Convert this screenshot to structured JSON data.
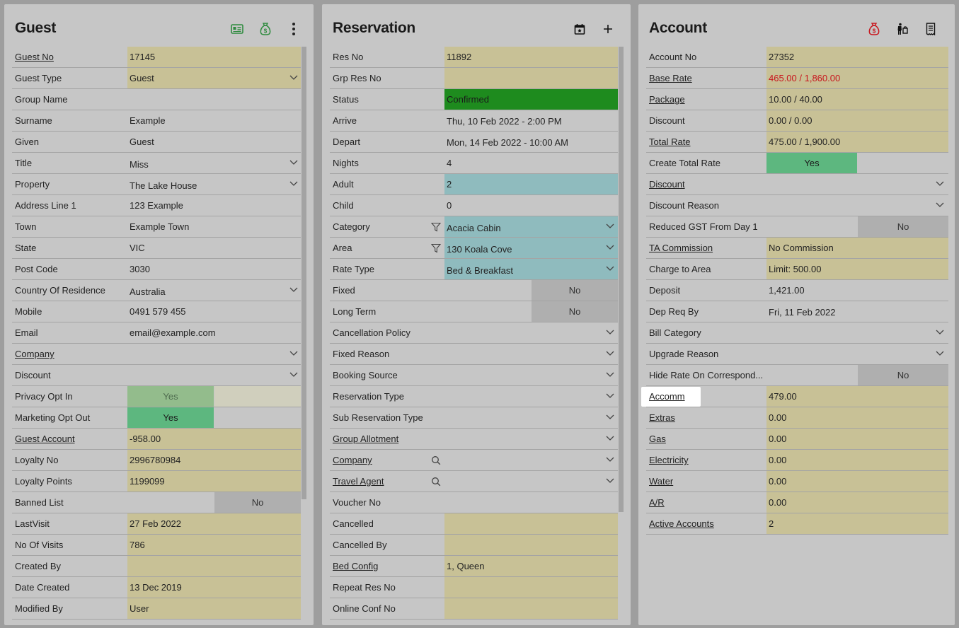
{
  "guest": {
    "title": "Guest",
    "icons": [
      "id-card-icon",
      "money-bag-icon",
      "more-menu-icon"
    ],
    "fields": {
      "guest_no": {
        "label": "Guest No",
        "value": "17145"
      },
      "guest_type": {
        "label": "Guest Type",
        "value": "Guest"
      },
      "group_name": {
        "label": "Group Name",
        "value": ""
      },
      "surname": {
        "label": "Surname",
        "value": "Example"
      },
      "given": {
        "label": "Given",
        "value": "Guest"
      },
      "title": {
        "label": "Title",
        "value": "Miss"
      },
      "property": {
        "label": "Property",
        "value": "The Lake House"
      },
      "address1": {
        "label": "Address Line 1",
        "value": "123 Example"
      },
      "town": {
        "label": "Town",
        "value": "Example Town"
      },
      "state": {
        "label": "State",
        "value": "VIC"
      },
      "post_code": {
        "label": "Post Code",
        "value": "3030"
      },
      "country": {
        "label": "Country Of Residence",
        "value": "Australia"
      },
      "mobile": {
        "label": "Mobile",
        "value": "0491 579 455"
      },
      "email": {
        "label": "Email",
        "value": "email@example.com"
      },
      "company": {
        "label": "Company",
        "value": ""
      },
      "discount": {
        "label": "Discount",
        "value": ""
      },
      "privacy": {
        "label": "Privacy Opt In",
        "value": "Yes"
      },
      "marketing": {
        "label": "Marketing Opt Out",
        "value": "Yes"
      },
      "guest_account": {
        "label": "Guest Account",
        "value": "-958.00"
      },
      "loyalty_no": {
        "label": "Loyalty No",
        "value": "2996780984"
      },
      "loyalty_points": {
        "label": "Loyalty Points",
        "value": "1199099"
      },
      "banned": {
        "label": "Banned List",
        "value": "No"
      },
      "last_visit": {
        "label": "LastVisit",
        "value": "27 Feb 2022"
      },
      "visits": {
        "label": "No Of Visits",
        "value": "786"
      },
      "created_by": {
        "label": "Created By",
        "value": ""
      },
      "date_created": {
        "label": "Date Created",
        "value": "13 Dec 2019"
      },
      "modified_by": {
        "label": "Modified By",
        "value": "User"
      }
    }
  },
  "reservation": {
    "title": "Reservation",
    "icons": [
      "calendar-icon",
      "add-icon"
    ],
    "fields": {
      "res_no": {
        "label": "Res No",
        "value": "11892"
      },
      "grp_res_no": {
        "label": "Grp Res No",
        "value": ""
      },
      "status": {
        "label": "Status",
        "value": "Confirmed"
      },
      "arrive": {
        "label": "Arrive",
        "value": "Thu, 10 Feb 2022 - 2:00 PM"
      },
      "depart": {
        "label": "Depart",
        "value": "Mon, 14 Feb 2022 - 10:00 AM"
      },
      "nights": {
        "label": "Nights",
        "value": "4"
      },
      "adult": {
        "label": "Adult",
        "value": "2"
      },
      "child": {
        "label": "Child",
        "value": "0"
      },
      "category": {
        "label": "Category",
        "value": "Acacia Cabin"
      },
      "area": {
        "label": "Area",
        "value": "130 Koala Cove"
      },
      "rate_type": {
        "label": "Rate Type",
        "value": "Bed & Breakfast"
      },
      "fixed": {
        "label": "Fixed",
        "value": "No"
      },
      "long_term": {
        "label": "Long Term",
        "value": "No"
      },
      "cancel_policy": {
        "label": "Cancellation Policy",
        "value": ""
      },
      "fixed_reason": {
        "label": "Fixed Reason",
        "value": ""
      },
      "booking_source": {
        "label": "Booking Source",
        "value": ""
      },
      "res_type": {
        "label": "Reservation Type",
        "value": ""
      },
      "sub_res_type": {
        "label": "Sub Reservation Type",
        "value": ""
      },
      "group_allot": {
        "label": "Group Allotment",
        "value": ""
      },
      "company": {
        "label": "Company",
        "value": ""
      },
      "travel_agent": {
        "label": "Travel Agent",
        "value": ""
      },
      "voucher_no": {
        "label": "Voucher No",
        "value": ""
      },
      "cancelled": {
        "label": "Cancelled",
        "value": ""
      },
      "cancelled_by": {
        "label": "Cancelled By",
        "value": ""
      },
      "bed_config": {
        "label": "Bed Config",
        "value": "1, Queen"
      },
      "repeat_res": {
        "label": "Repeat Res No",
        "value": ""
      },
      "online_conf": {
        "label": "Online Conf No",
        "value": ""
      }
    }
  },
  "account": {
    "title": "Account",
    "icons": [
      "money-bag-icon",
      "guest-luggage-icon",
      "receipt-icon"
    ],
    "fields": {
      "account_no": {
        "label": "Account No",
        "value": "27352"
      },
      "base_rate": {
        "label": "Base Rate",
        "value": "465.00 / 1,860.00"
      },
      "package": {
        "label": "Package",
        "value": "10.00 / 40.00"
      },
      "discount": {
        "label": "Discount",
        "value": "0.00 / 0.00"
      },
      "total_rate": {
        "label": "Total Rate",
        "value": "475.00 / 1,900.00"
      },
      "create_total": {
        "label": "Create Total Rate",
        "value": "Yes"
      },
      "discount2": {
        "label": "Discount",
        "value": ""
      },
      "discount_reason": {
        "label": "Discount Reason",
        "value": ""
      },
      "reduced_gst": {
        "label": "Reduced GST From Day 1",
        "value": "No"
      },
      "ta_commission": {
        "label": "TA Commission",
        "value": "No Commission"
      },
      "charge_area": {
        "label": "Charge to Area",
        "value": "Limit: 500.00"
      },
      "deposit": {
        "label": "Deposit",
        "value": "1,421.00"
      },
      "dep_req_by": {
        "label": "Dep Req By",
        "value": "Fri, 11 Feb 2022"
      },
      "bill_category": {
        "label": "Bill Category",
        "value": ""
      },
      "upgrade_reason": {
        "label": "Upgrade Reason",
        "value": ""
      },
      "hide_rate": {
        "label": "Hide Rate On Correspond...",
        "value": "No"
      },
      "accomm": {
        "label": "Accomm",
        "value": "479.00"
      },
      "extras": {
        "label": "Extras",
        "value": "0.00"
      },
      "gas": {
        "label": "Gas",
        "value": "0.00"
      },
      "electricity": {
        "label": "Electricity",
        "value": "0.00"
      },
      "water": {
        "label": "Water",
        "value": "0.00"
      },
      "ar": {
        "label": "A/R",
        "value": "0.00"
      },
      "active_accounts": {
        "label": "Active Accounts",
        "value": "2"
      }
    }
  },
  "colors": {
    "yellow_field": "#c8c196",
    "teal_field": "#8fbbbe",
    "status_green": "#1e8b1e",
    "toggle_yes": "#5db77f",
    "toggle_no": "#afafaf",
    "alert_red": "#c8161d"
  }
}
